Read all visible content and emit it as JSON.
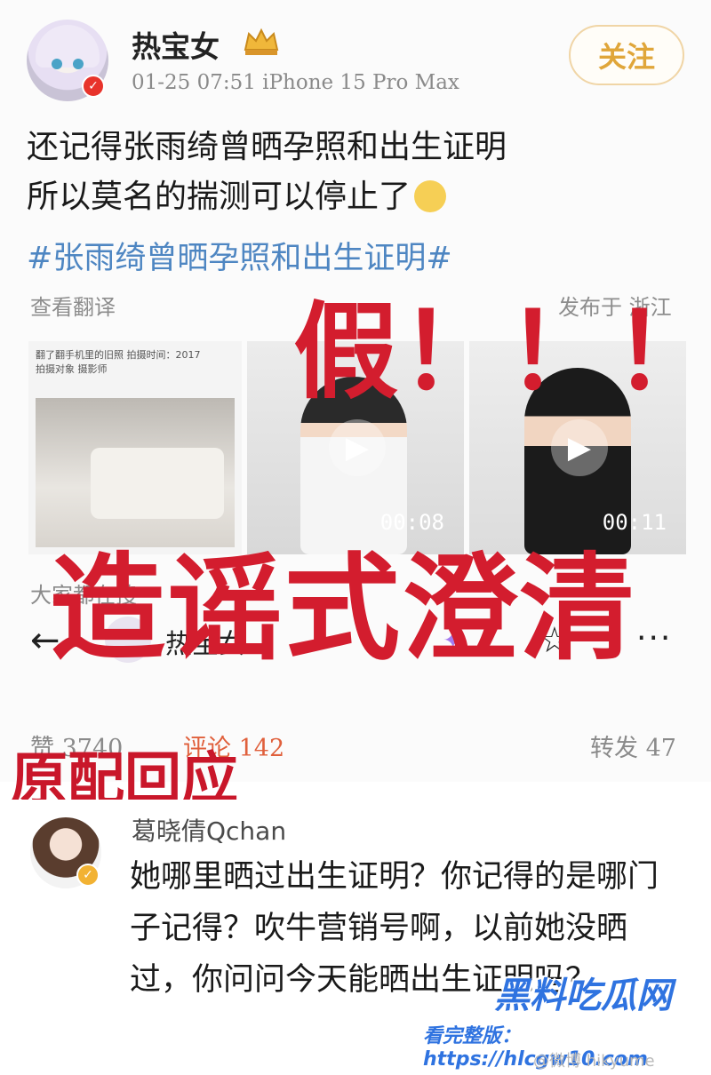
{
  "post": {
    "username": "热宝女",
    "meta": "01-25 07:51   iPhone 15 Pro Max",
    "follow_label": "关注",
    "line1": "还记得张雨绮曾晒孕照和出生证明",
    "line2": "所以莫名的揣测可以停止了",
    "hashtag": "#张雨绮曾晒孕照和出生证明#",
    "translate": "查看翻译",
    "location": "发布于 浙江",
    "embedded_note": "翻了翻手机里的旧照 拍摄时间：2017\n拍摄对象 摄影师",
    "video1_duration": "00:08",
    "video2_duration": "00:11",
    "see_also": "大家都在搜"
  },
  "nav": {
    "back_icon": "←",
    "name": "热宝女",
    "sparkle_icon": "✦",
    "star_icon": "☆",
    "more_icon": "···"
  },
  "stats": {
    "like": "赞 3740",
    "comment": "评论 142",
    "repost": "转发 47"
  },
  "overlay": {
    "fake": "假！！！",
    "rumor": "造谣式澄清",
    "reply_label": "原配回应"
  },
  "reply": {
    "name": "葛晓倩Qchan",
    "text": "她哪里晒过出生证明？你记得的是哪门子记得？吹牛营销号啊，以前她没晒过，你问问今天能晒出生证明吗？"
  },
  "watermark": {
    "logo": "黑料吃瓜网",
    "url": "看完整版：https://hlcgw10.com",
    "weibo": "@微博 hikyume"
  },
  "colors": {
    "accent_red": "#d31d2e",
    "link_blue": "#4e86c2",
    "follow_gold": "#e0a63a"
  }
}
